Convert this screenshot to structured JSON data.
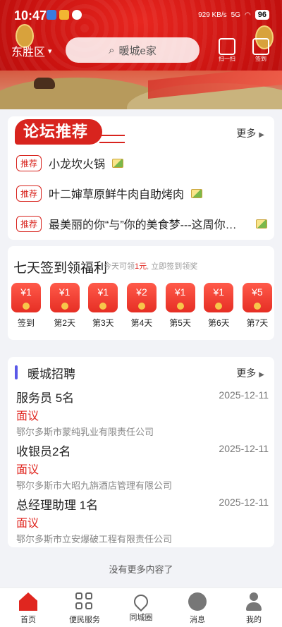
{
  "status_bar": {
    "time": "10:47",
    "net": "929 KB/s",
    "signal": "5G",
    "battery": "96"
  },
  "header": {
    "location": "东胜区",
    "search_placeholder": "暖城e家",
    "scan_label": "扫一扫",
    "signin_label": "签到"
  },
  "forum": {
    "logo": "论坛推荐",
    "more": "更多",
    "tag": "推荐",
    "items": [
      {
        "title": "小龙坎火锅"
      },
      {
        "title": "叶二婶草原鲜牛肉自助烤肉"
      },
      {
        "title": "最美丽的你“与”你的美食梦---这周你…"
      }
    ]
  },
  "signin_card": {
    "title": "七天签到领福利",
    "sub_prefix": "今天可领",
    "sub_amount": "1元",
    "sub_suffix": ", 立即签到领奖",
    "days": [
      {
        "amount": "¥1",
        "label": "签到"
      },
      {
        "amount": "¥1",
        "label": "第2天"
      },
      {
        "amount": "¥1",
        "label": "第3天"
      },
      {
        "amount": "¥2",
        "label": "第4天"
      },
      {
        "amount": "¥1",
        "label": "第5天"
      },
      {
        "amount": "¥1",
        "label": "第6天"
      },
      {
        "amount": "¥5",
        "label": "第7天"
      }
    ]
  },
  "jobs": {
    "title": "暖城招聘",
    "more": "更多",
    "items": [
      {
        "title": "服务员 5名",
        "date": "2025-12-11",
        "salary": "面议",
        "company": "鄂尔多斯市蒙纯乳业有限责任公司"
      },
      {
        "title": "收银员2名",
        "date": "2025-12-11",
        "salary": "面议",
        "company": "鄂尔多斯市大昭九旃酒店管理有限公司"
      },
      {
        "title": "总经理助理 1名",
        "date": "2025-12-11",
        "salary": "面议",
        "company": "鄂尔多斯市立安爆破工程有限责任公司"
      }
    ]
  },
  "no_more": "没有更多内容了",
  "nav": [
    {
      "label": "首页",
      "icon": "home-icon",
      "active": true
    },
    {
      "label": "便民服务",
      "icon": "grid-icon"
    },
    {
      "label": "同城圈",
      "icon": "location-pin-icon"
    },
    {
      "label": "消息",
      "icon": "chat-icon"
    },
    {
      "label": "我的",
      "icon": "user-icon"
    }
  ],
  "colors": {
    "brand_red": "#e0261f",
    "accent_purple": "#5a58e8"
  }
}
